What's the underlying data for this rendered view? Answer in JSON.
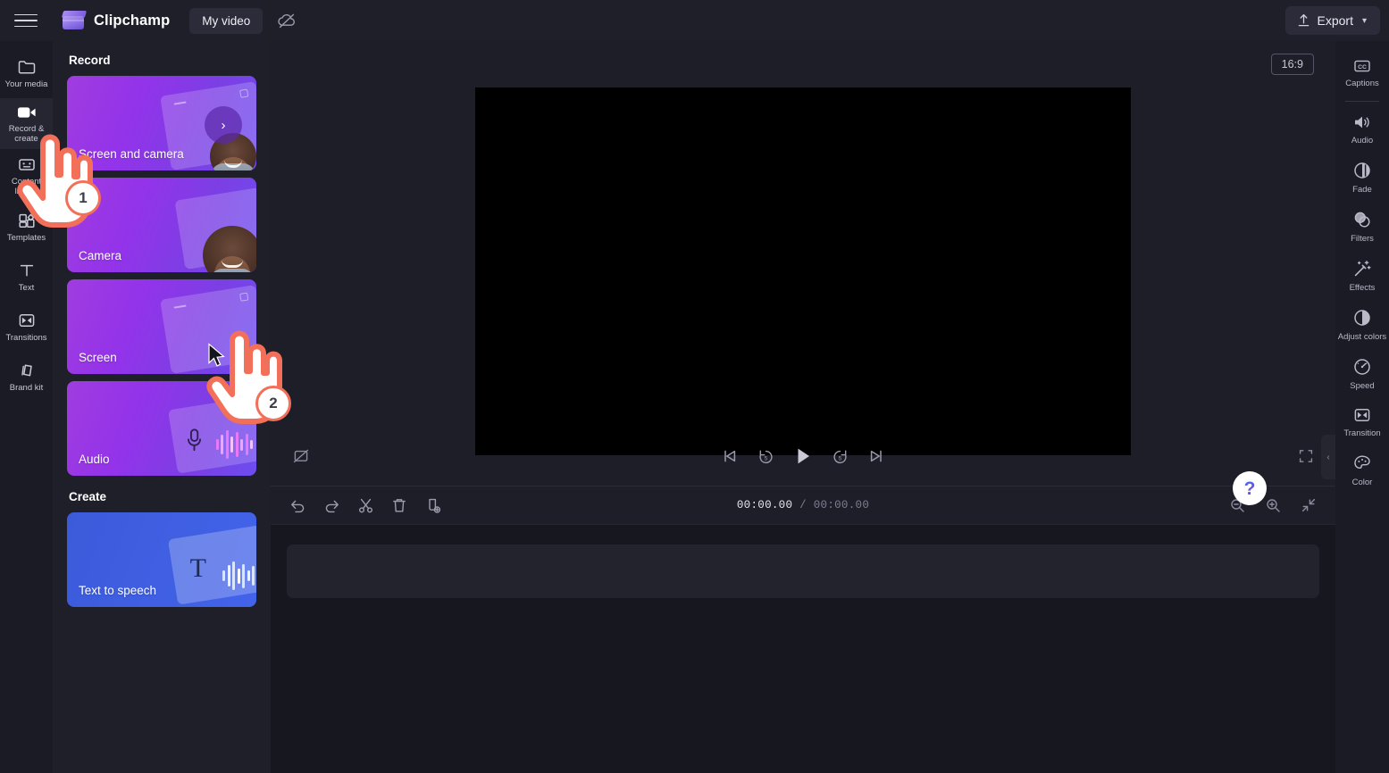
{
  "app": {
    "brand_name": "Clipchamp",
    "project_name": "My video",
    "menu_icon": "hamburger-icon",
    "cloud_icon": "cloud-off-icon",
    "export_label": "Export"
  },
  "left_rail": {
    "items": [
      {
        "label": "Your media",
        "icon": "folder-icon",
        "active": false
      },
      {
        "label": "Record & create",
        "icon": "video-camera-icon",
        "active": true
      },
      {
        "label": "Content library",
        "icon": "content-library-icon",
        "active": false
      },
      {
        "label": "Templates",
        "icon": "templates-icon",
        "active": false
      },
      {
        "label": "Text",
        "icon": "text-icon",
        "active": false
      },
      {
        "label": "Transitions",
        "icon": "transitions-icon",
        "active": false
      },
      {
        "label": "Brand kit",
        "icon": "brand-kit-icon",
        "active": false
      }
    ]
  },
  "panel": {
    "record_heading": "Record",
    "create_heading": "Create",
    "record_cards": [
      {
        "label": "Screen and camera",
        "art": "screen-and-camera-art",
        "chevron": "chevron-right-icon"
      },
      {
        "label": "Camera",
        "art": "camera-art"
      },
      {
        "label": "Screen",
        "art": "screen-art"
      },
      {
        "label": "Audio",
        "art": "audio-art"
      }
    ],
    "create_cards": [
      {
        "label": "Text to speech",
        "art": "text-to-speech-art"
      }
    ]
  },
  "preview": {
    "aspect_ratio": "16:9",
    "controls": [
      {
        "name": "toggle-crop",
        "icon": "crop-off-icon"
      },
      {
        "name": "skip-to-start",
        "icon": "skip-start-icon"
      },
      {
        "name": "rewind-5-seconds",
        "icon": "rewind-5-icon"
      },
      {
        "name": "play",
        "icon": "play-icon"
      },
      {
        "name": "forward-5-seconds",
        "icon": "forward-5-icon"
      },
      {
        "name": "skip-to-end",
        "icon": "skip-end-icon"
      },
      {
        "name": "fullscreen",
        "icon": "fullscreen-icon"
      }
    ]
  },
  "timeline": {
    "tools": [
      {
        "name": "undo",
        "icon": "undo-icon"
      },
      {
        "name": "redo",
        "icon": "redo-icon"
      },
      {
        "name": "split",
        "icon": "scissors-icon"
      },
      {
        "name": "delete",
        "icon": "trash-icon"
      },
      {
        "name": "duplicate",
        "icon": "duplicate-icon"
      }
    ],
    "current_time": "00:00.00",
    "separator": "/",
    "total_time": "00:00.00",
    "zoom_tools": [
      {
        "name": "zoom-out",
        "icon": "zoom-out-icon"
      },
      {
        "name": "zoom-in",
        "icon": "zoom-in-icon"
      },
      {
        "name": "fit-to-screen",
        "icon": "fit-screen-icon"
      }
    ]
  },
  "right_rail": {
    "items": [
      {
        "label": "Captions",
        "icon": "closed-captions-icon",
        "divider_after": true
      },
      {
        "label": "Audio",
        "icon": "speaker-icon"
      },
      {
        "label": "Fade",
        "icon": "fade-icon"
      },
      {
        "label": "Filters",
        "icon": "filters-icon"
      },
      {
        "label": "Effects",
        "icon": "magic-wand-icon"
      },
      {
        "label": "Adjust colors",
        "icon": "contrast-icon"
      },
      {
        "label": "Speed",
        "icon": "speedometer-icon"
      },
      {
        "label": "Transition",
        "icon": "transitions-icon"
      },
      {
        "label": "Color",
        "icon": "palette-icon"
      }
    ]
  },
  "overlays": {
    "collapse_chevron": "‹",
    "help_label": "?",
    "annotations": [
      {
        "number": "1",
        "target": "record-and-create-rail-item"
      },
      {
        "number": "2",
        "target": "screen-record-card"
      }
    ]
  }
}
